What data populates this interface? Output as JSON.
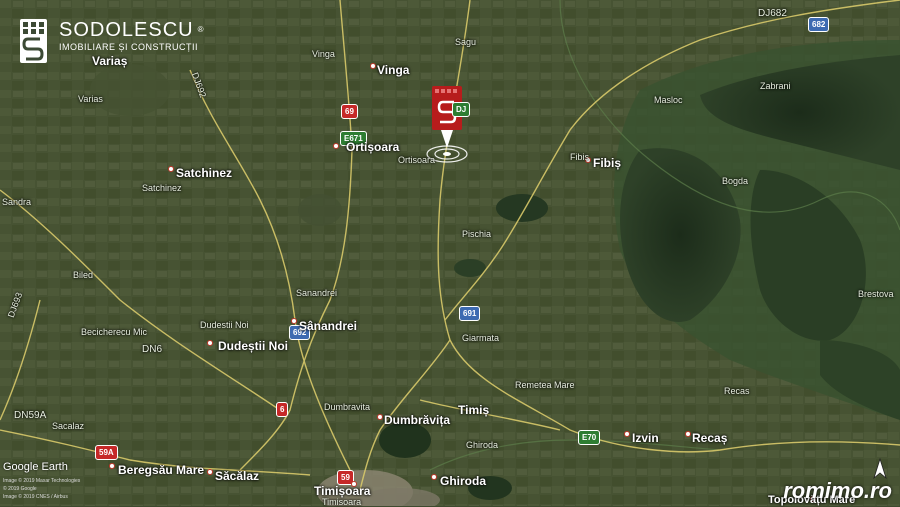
{
  "logo": {
    "name": "SODOLESCU",
    "tagline": "IMOBILIARE ȘI CONSTRUCȚII",
    "registered": "®"
  },
  "attribution": {
    "provider": "Google Earth",
    "lines": [
      "Image © 2019 Maxar Technologies",
      "© 2019 Google",
      "Image © 2019 CNES / Airbus"
    ]
  },
  "watermark": "romimo.ro",
  "places": {
    "vinga": "Vinga",
    "vinga_small": "Vinga",
    "sagu": "Sagu",
    "varias": "Variaș",
    "varias_small": "Varias",
    "ortisoara": "Ortișoara",
    "ortisoara_small": "Ortisoara",
    "satchinez": "Satchinez",
    "satchinez_small": "Satchinez",
    "sandra": "Sandra",
    "biled": "Biled",
    "pischia": "Pischia",
    "fibis": "Fibiș",
    "fibis_small": "Fibis",
    "masloc": "Masloc",
    "zabrani": "Zabrani",
    "bogda": "Bogda",
    "brestovat": "Brestova",
    "sanandrei": "Sânandrei",
    "sanandrei_small": "Sanandrei",
    "dudestii_noi": "Dudeștii Noi",
    "dudestii_noi_small": "Dudestii Noi",
    "becicherecu_mic": "Becicherecu Mic",
    "giarmata": "Giarmata",
    "remetea_mare": "Remetea Mare",
    "recas": "Recaș",
    "recas_small": "Recas",
    "izvin": "Izvin",
    "dumbravita": "Dumbrăvița",
    "dumbravita_small": "Dumbravita",
    "timis": "Timiș",
    "ghiroda": "Ghiroda",
    "ghiroda_small": "Ghiroda",
    "sacalaz": "Săcălaz",
    "sacalaz_small": "Sacalaz",
    "beregsau_mare": "Beregsău Mare",
    "timisoara": "Timișoara",
    "timisoara_small": "Timisoara",
    "topolovatu_mare": "Topolovățu Mare"
  },
  "roads": {
    "dj682": "DJ682",
    "dn6": "DN6",
    "dn59a": "DN59A",
    "dj692": "DJ692",
    "dj693": "DJ693"
  },
  "shields": {
    "r69": "69",
    "e671": "E671",
    "r682": "682",
    "r691": "691",
    "r692": "692",
    "r6": "6",
    "r59a": "59A",
    "r59": "59",
    "e70": "E70",
    "dj": "DJ"
  },
  "colors": {
    "fields": "#4f5a3a",
    "forest": "#263a22",
    "road": "#d8c96a",
    "brand_red": "#b71c1c",
    "shield_red": "#c62828",
    "shield_blue": "#3d6ab1",
    "shield_green": "#2e7d32"
  }
}
